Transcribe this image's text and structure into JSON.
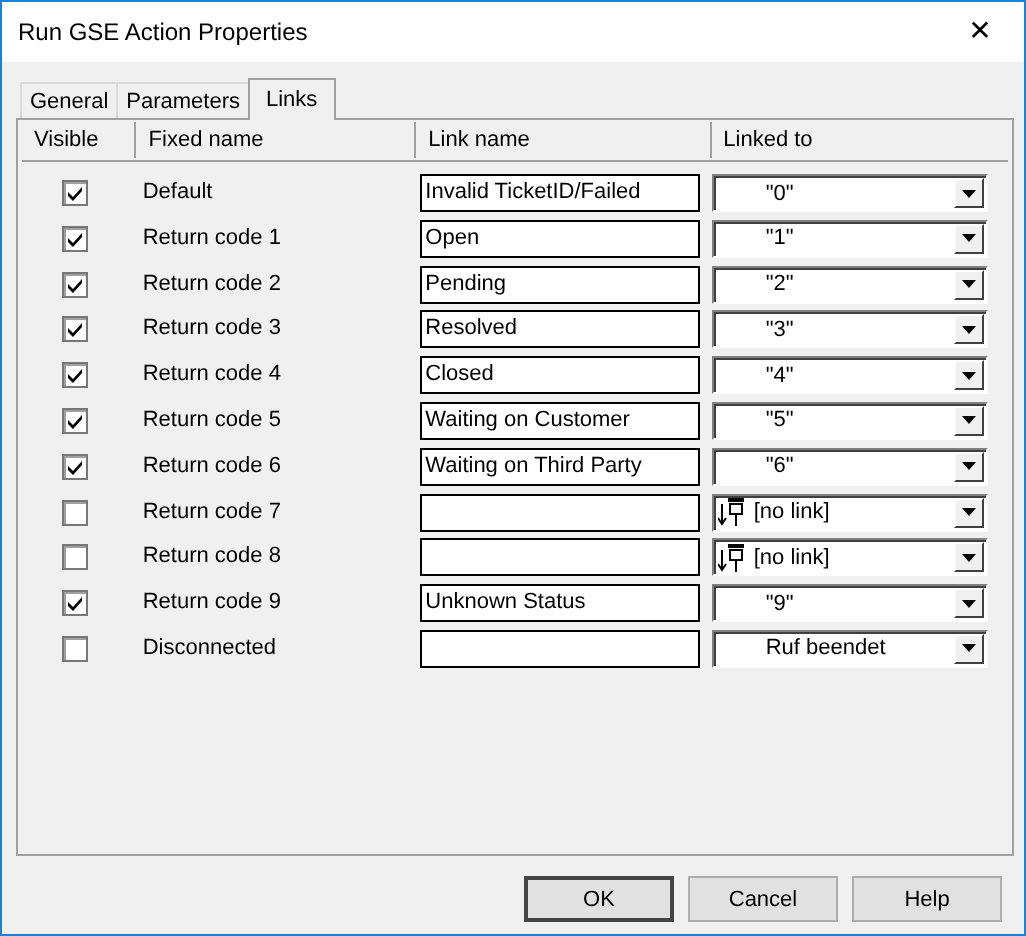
{
  "window": {
    "title": "Run GSE Action Properties",
    "close": "✕"
  },
  "tabs": [
    {
      "label": "General",
      "selected": false
    },
    {
      "label": "Parameters",
      "selected": false
    },
    {
      "label": "Links",
      "selected": true
    }
  ],
  "table": {
    "columns": [
      "Visible",
      "Fixed name",
      "Link name",
      "Linked to"
    ],
    "rows": [
      {
        "visible": true,
        "fixed_name": "Default",
        "link_name": "Invalid TicketID/Failed",
        "linked_to": {
          "kind": "value",
          "text": "\"0\""
        }
      },
      {
        "visible": true,
        "fixed_name": "Return code 1",
        "link_name": "Open",
        "linked_to": {
          "kind": "value",
          "text": "\"1\""
        }
      },
      {
        "visible": true,
        "fixed_name": "Return code 2",
        "link_name": "Pending",
        "linked_to": {
          "kind": "value",
          "text": "\"2\""
        }
      },
      {
        "visible": true,
        "fixed_name": "Return code 3",
        "link_name": "Resolved",
        "linked_to": {
          "kind": "value",
          "text": "\"3\""
        }
      },
      {
        "visible": true,
        "fixed_name": "Return code 4",
        "link_name": "Closed",
        "linked_to": {
          "kind": "value",
          "text": "\"4\""
        }
      },
      {
        "visible": true,
        "fixed_name": "Return code 5",
        "link_name": "Waiting on Customer",
        "linked_to": {
          "kind": "value",
          "text": "\"5\""
        }
      },
      {
        "visible": true,
        "fixed_name": "Return code 6",
        "link_name": "Waiting on Third Party",
        "linked_to": {
          "kind": "value",
          "text": "\"6\""
        }
      },
      {
        "visible": false,
        "fixed_name": "Return code 7",
        "linked_to": {
          "kind": "nolink",
          "text": "[no link]"
        }
      },
      {
        "visible": false,
        "fixed_name": "Return code 8",
        "linked_to": {
          "kind": "nolink",
          "text": "[no link]"
        }
      },
      {
        "visible": true,
        "fixed_name": "Return code 9",
        "link_name": "Unknown Status",
        "linked_to": {
          "kind": "value",
          "text": "\"9\""
        }
      },
      {
        "visible": false,
        "fixed_name": "Disconnected",
        "linked_to": {
          "kind": "value",
          "text": "Ruf beendet"
        }
      }
    ]
  },
  "buttons": [
    "OK",
    "Cancel",
    "Help"
  ]
}
